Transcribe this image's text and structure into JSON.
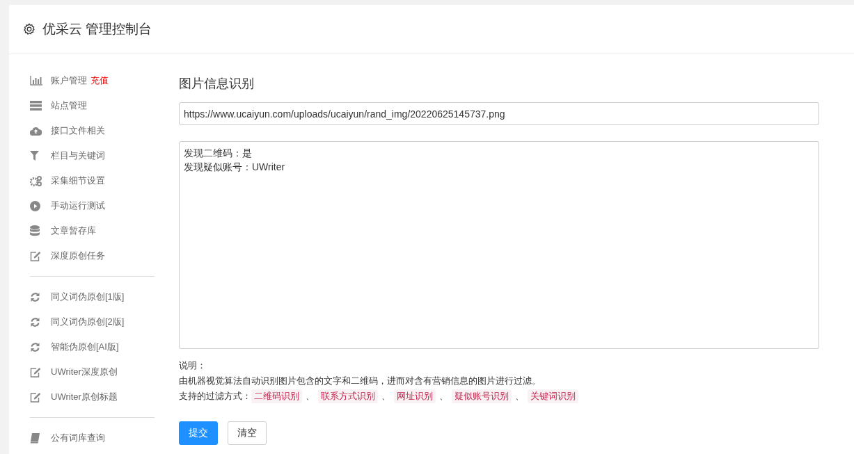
{
  "header": {
    "title": "优采云 管理控制台"
  },
  "sidebar": {
    "groups": [
      {
        "items": [
          {
            "label": "账户管理",
            "badge": "充值"
          },
          {
            "label": "站点管理"
          },
          {
            "label": "接口文件相关"
          },
          {
            "label": "栏目与关键词"
          },
          {
            "label": "采集细节设置"
          },
          {
            "label": "手动运行测试"
          },
          {
            "label": "文章暂存库"
          },
          {
            "label": "深度原创任务"
          }
        ]
      },
      {
        "items": [
          {
            "label": "同义词伪原创[1版]"
          },
          {
            "label": "同义词伪原创[2版]"
          },
          {
            "label": "智能伪原创[AI版]"
          },
          {
            "label": "UWriter深度原创"
          },
          {
            "label": "UWriter原创标题"
          }
        ]
      },
      {
        "items": [
          {
            "label": "公有词库查询"
          }
        ]
      }
    ]
  },
  "main": {
    "title": "图片信息识别",
    "url_field": {
      "value": "https://www.ucaiyun.com/uploads/ucaiyun/rand_img/20220625145737.png"
    },
    "result_box": {
      "lines": [
        "发现二维码：是",
        "发现疑似账号：UWriter"
      ]
    },
    "note_label": "说明：",
    "note_text": "由机器视觉算法自动识别图片包含的文字和二维码，进而对含有营销信息的图片进行过滤。",
    "filters_label": "支持的过滤方式：",
    "filters": [
      "二维码识别",
      "联系方式识别",
      "网址识别",
      "疑似账号识别",
      "关键词识别"
    ],
    "separator": "、",
    "buttons": [
      {
        "label": "提交",
        "kind": "primary"
      },
      {
        "label": "清空",
        "kind": "default"
      }
    ]
  }
}
